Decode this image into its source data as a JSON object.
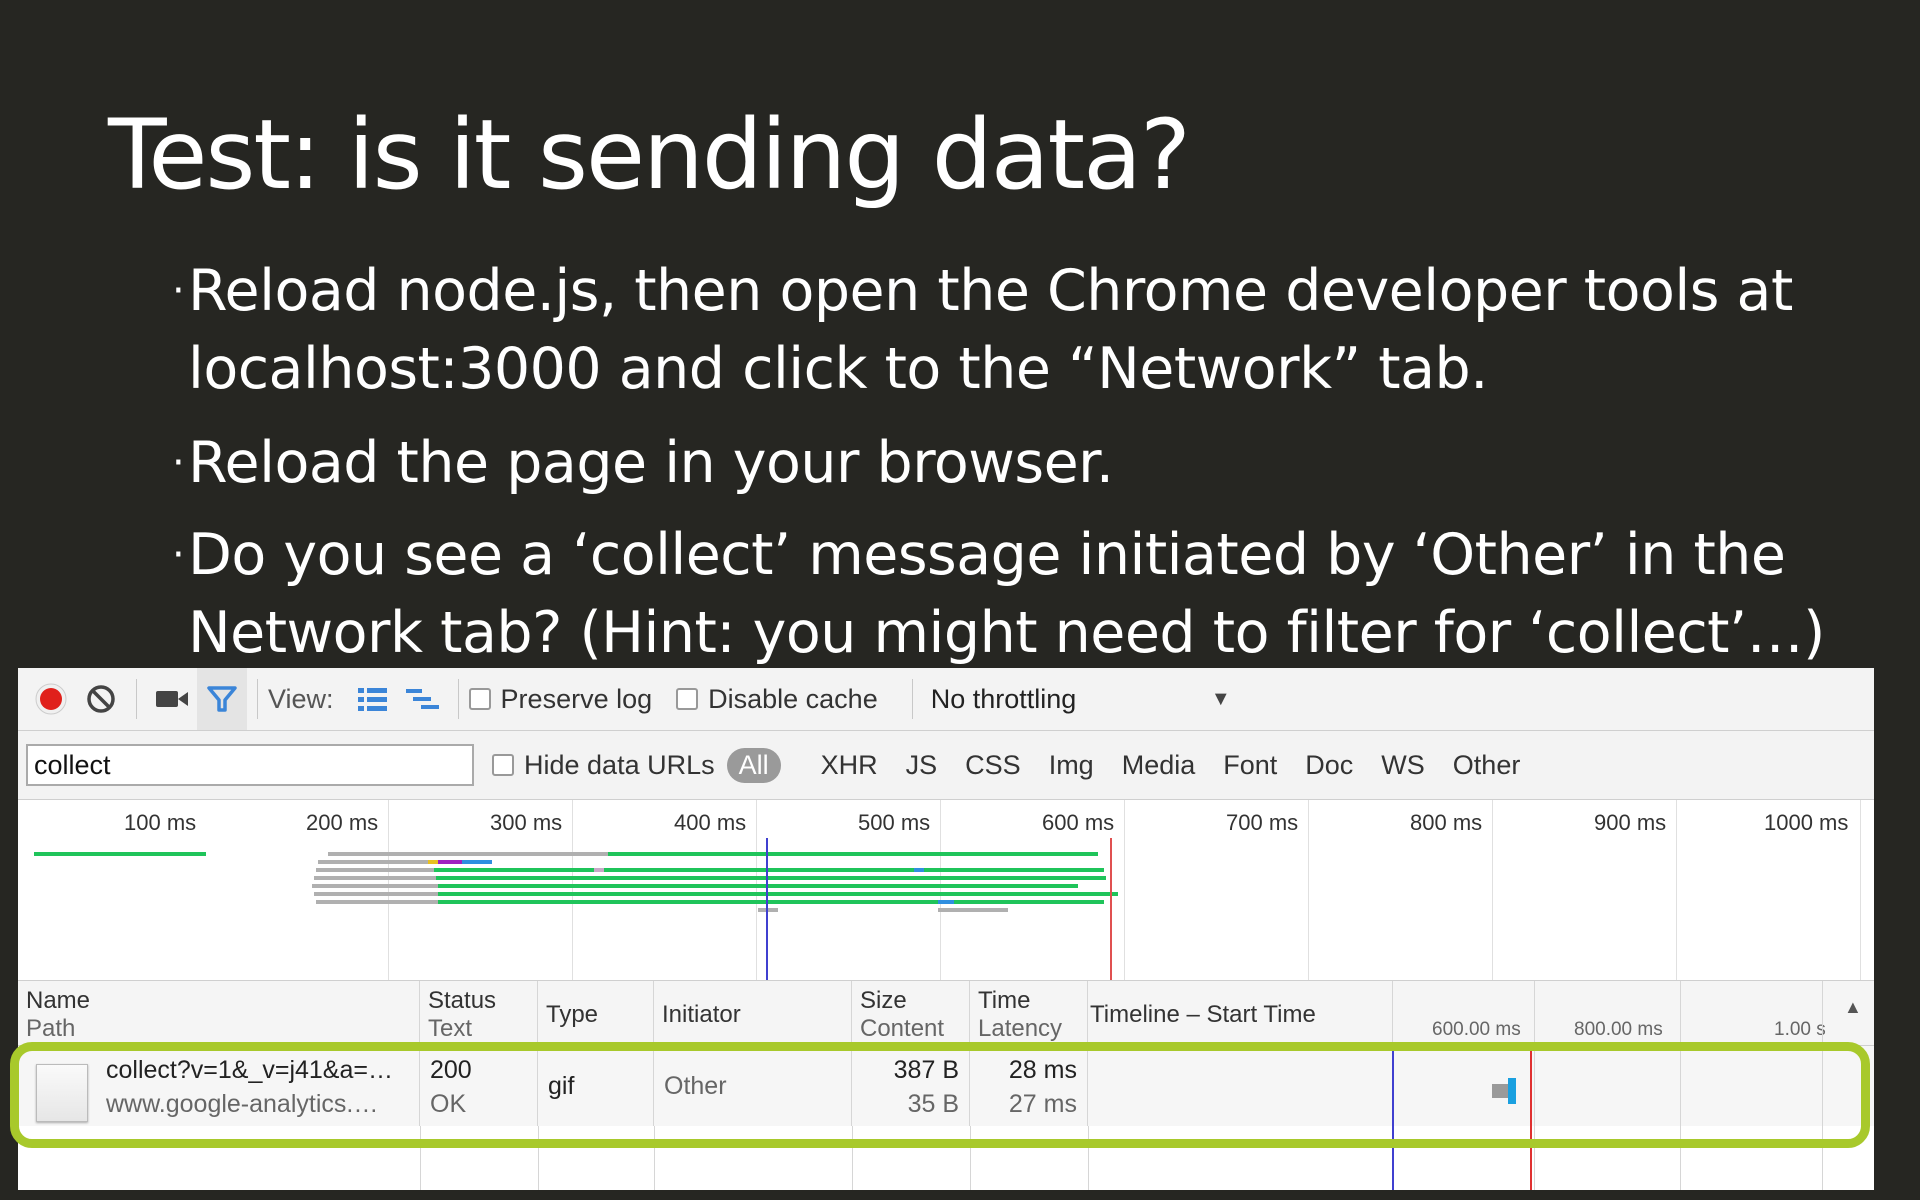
{
  "slide": {
    "title": "Test: is it sending data?",
    "bullets": [
      {
        "line1": "Reload node.js, then open the Chrome developer tools at",
        "line2": "localhost:3000 and click to the “Network” tab."
      },
      {
        "line1": "Reload the page in your browser."
      },
      {
        "line1": "Do you see a ‘collect’ message initiated by ‘Other’ in the",
        "line2": "Network tab? (Hint: you might need to filter for ‘collect’…)"
      }
    ],
    "bullet_glyph": "·"
  },
  "devtools": {
    "toolbar": {
      "view_label": "View:",
      "preserve_log": "Preserve log",
      "disable_cache": "Disable cache",
      "throttling": "No throttling",
      "dropdown_arrow": "▼"
    },
    "filter": {
      "value": "collect",
      "hide_data_urls": "Hide data URLs",
      "types": [
        "All",
        "XHR",
        "JS",
        "CSS",
        "Img",
        "Media",
        "Font",
        "Doc",
        "WS",
        "Other"
      ]
    },
    "overview_ticks": [
      "100 ms",
      "200 ms",
      "300 ms",
      "400 ms",
      "500 ms",
      "600 ms",
      "700 ms",
      "800 ms",
      "900 ms",
      "1000 ms"
    ],
    "columns": {
      "name": "Name",
      "path": "Path",
      "status": "Status",
      "status_text": "Text",
      "type": "Type",
      "initiator": "Initiator",
      "size": "Size",
      "content": "Content",
      "time": "Time",
      "latency": "Latency",
      "timeline": "Timeline – Start Time",
      "timeline_ticks": [
        "600.00 ms",
        "800.00 ms",
        "1.00 s"
      ],
      "sort_arrow": "▲"
    },
    "rows": [
      {
        "name": "collect?v=1&_v=j41&a=…",
        "path": "www.google-analytics.…",
        "status": "200",
        "status_text": "OK",
        "type": "gif",
        "initiator": "Other",
        "size": "387 B",
        "content": "35 B",
        "time": "28 ms",
        "latency": "27 ms"
      }
    ],
    "colors": {
      "record": "#e0201b",
      "filter_active": "#3b85d8",
      "highlight": "#a8c92b",
      "bar_green": "#1fc45a",
      "bar_gray": "#b0b0b0",
      "bar_blue": "#2f8fe0"
    }
  }
}
